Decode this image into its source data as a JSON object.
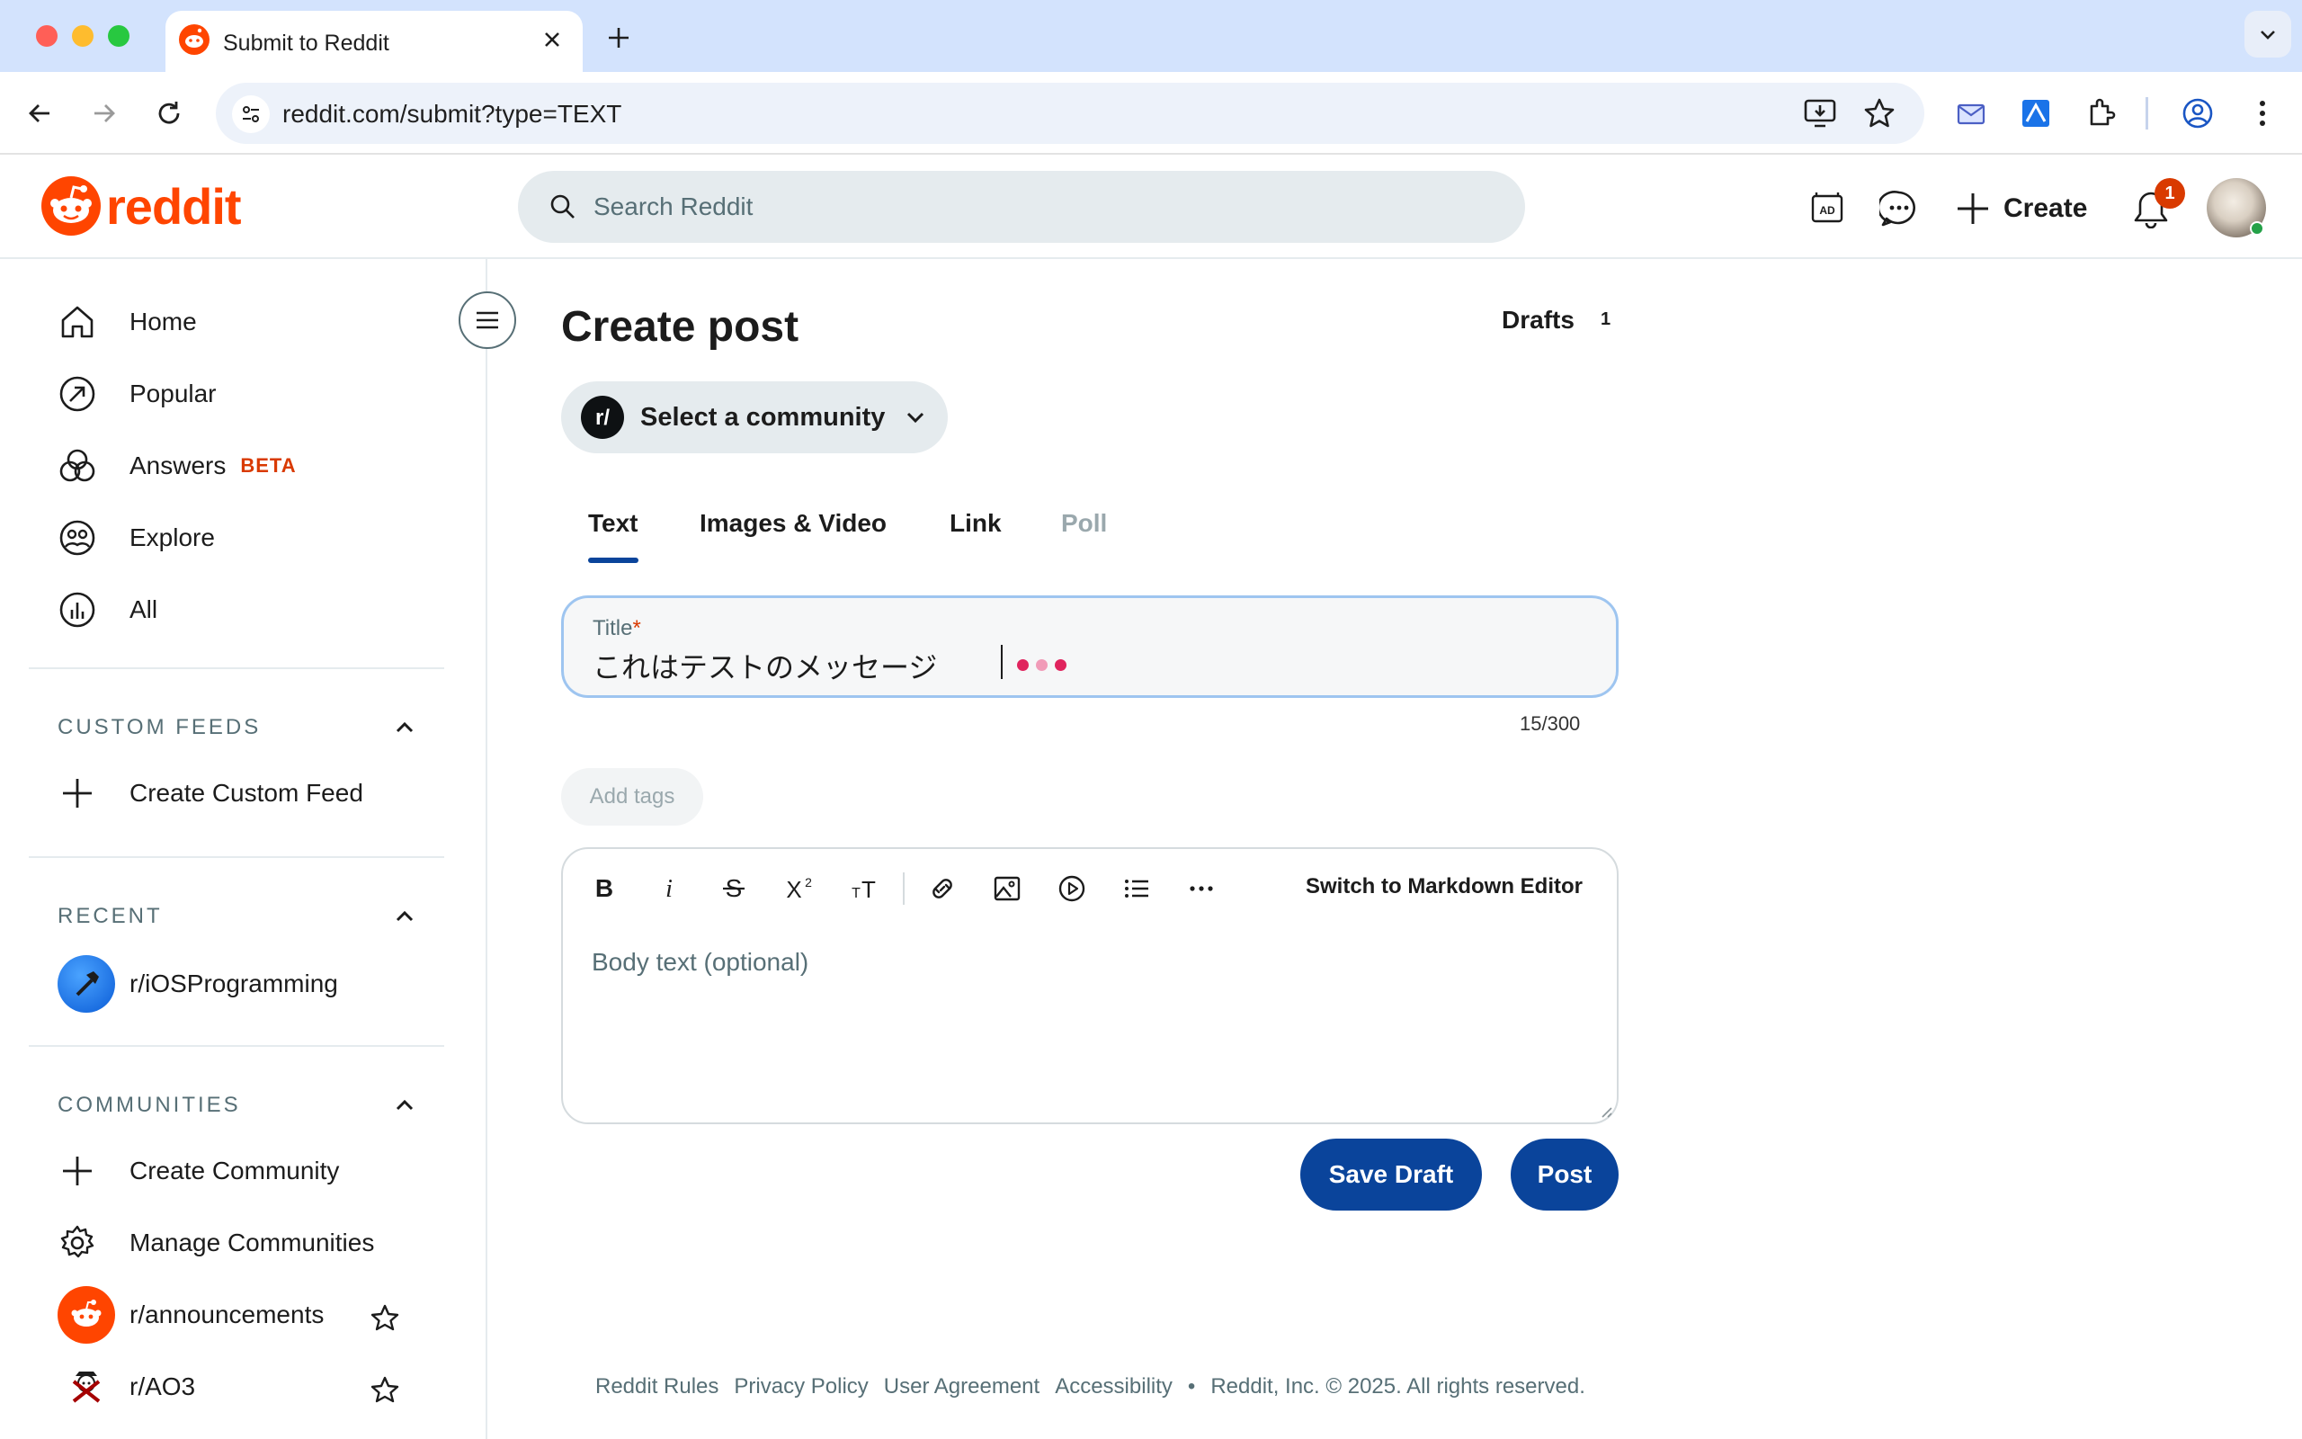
{
  "browser": {
    "tab_title": "Submit to Reddit",
    "url": "reddit.com/submit?type=TEXT"
  },
  "header": {
    "logo_text": "reddit",
    "search_placeholder": "Search Reddit",
    "create_label": "Create",
    "notification_count": "1"
  },
  "sidebar": {
    "nav": [
      {
        "label": "Home",
        "icon": "home-icon"
      },
      {
        "label": "Popular",
        "icon": "popular-icon"
      },
      {
        "label": "Answers",
        "icon": "answers-icon",
        "badge": "BETA"
      },
      {
        "label": "Explore",
        "icon": "explore-icon"
      },
      {
        "label": "All",
        "icon": "all-icon"
      }
    ],
    "custom_feeds": {
      "header": "CUSTOM FEEDS",
      "create_label": "Create Custom Feed"
    },
    "recent": {
      "header": "RECENT",
      "items": [
        "r/iOSProgramming"
      ]
    },
    "communities": {
      "header": "COMMUNITIES",
      "create_label": "Create Community",
      "manage_label": "Manage Communities",
      "items": [
        "r/announcements",
        "r/AO3"
      ]
    }
  },
  "main": {
    "title": "Create post",
    "drafts_label": "Drafts",
    "drafts_count": "1",
    "community_select_label": "Select a community",
    "tabs": [
      "Text",
      "Images & Video",
      "Link",
      "Poll"
    ],
    "active_tab": "Text",
    "title_field": {
      "label": "Title",
      "required_mark": "*",
      "value": "これはテストのメッセージ",
      "char_count": "15/300"
    },
    "add_tags_label": "Add tags",
    "editor": {
      "switch_label": "Switch to Markdown Editor",
      "body_placeholder": "Body text (optional)",
      "tools": [
        "bold-icon",
        "italic-icon",
        "strikethrough-icon",
        "superscript-icon",
        "heading-icon",
        "link-icon",
        "image-icon",
        "video-icon",
        "bullet-list-icon",
        "more-icon"
      ]
    },
    "save_draft_label": "Save Draft",
    "post_label": "Post"
  },
  "footer": {
    "links": [
      "Reddit Rules",
      "Privacy Policy",
      "User Agreement",
      "Accessibility"
    ],
    "separator": "•",
    "copyright": "Reddit, Inc. © 2025. All rights reserved."
  },
  "colors": {
    "reddit_orange": "#ff4500",
    "primary_button": "#0a449b",
    "tab_active_underline": "#0a449b",
    "beta_badge": "#d93a00"
  }
}
